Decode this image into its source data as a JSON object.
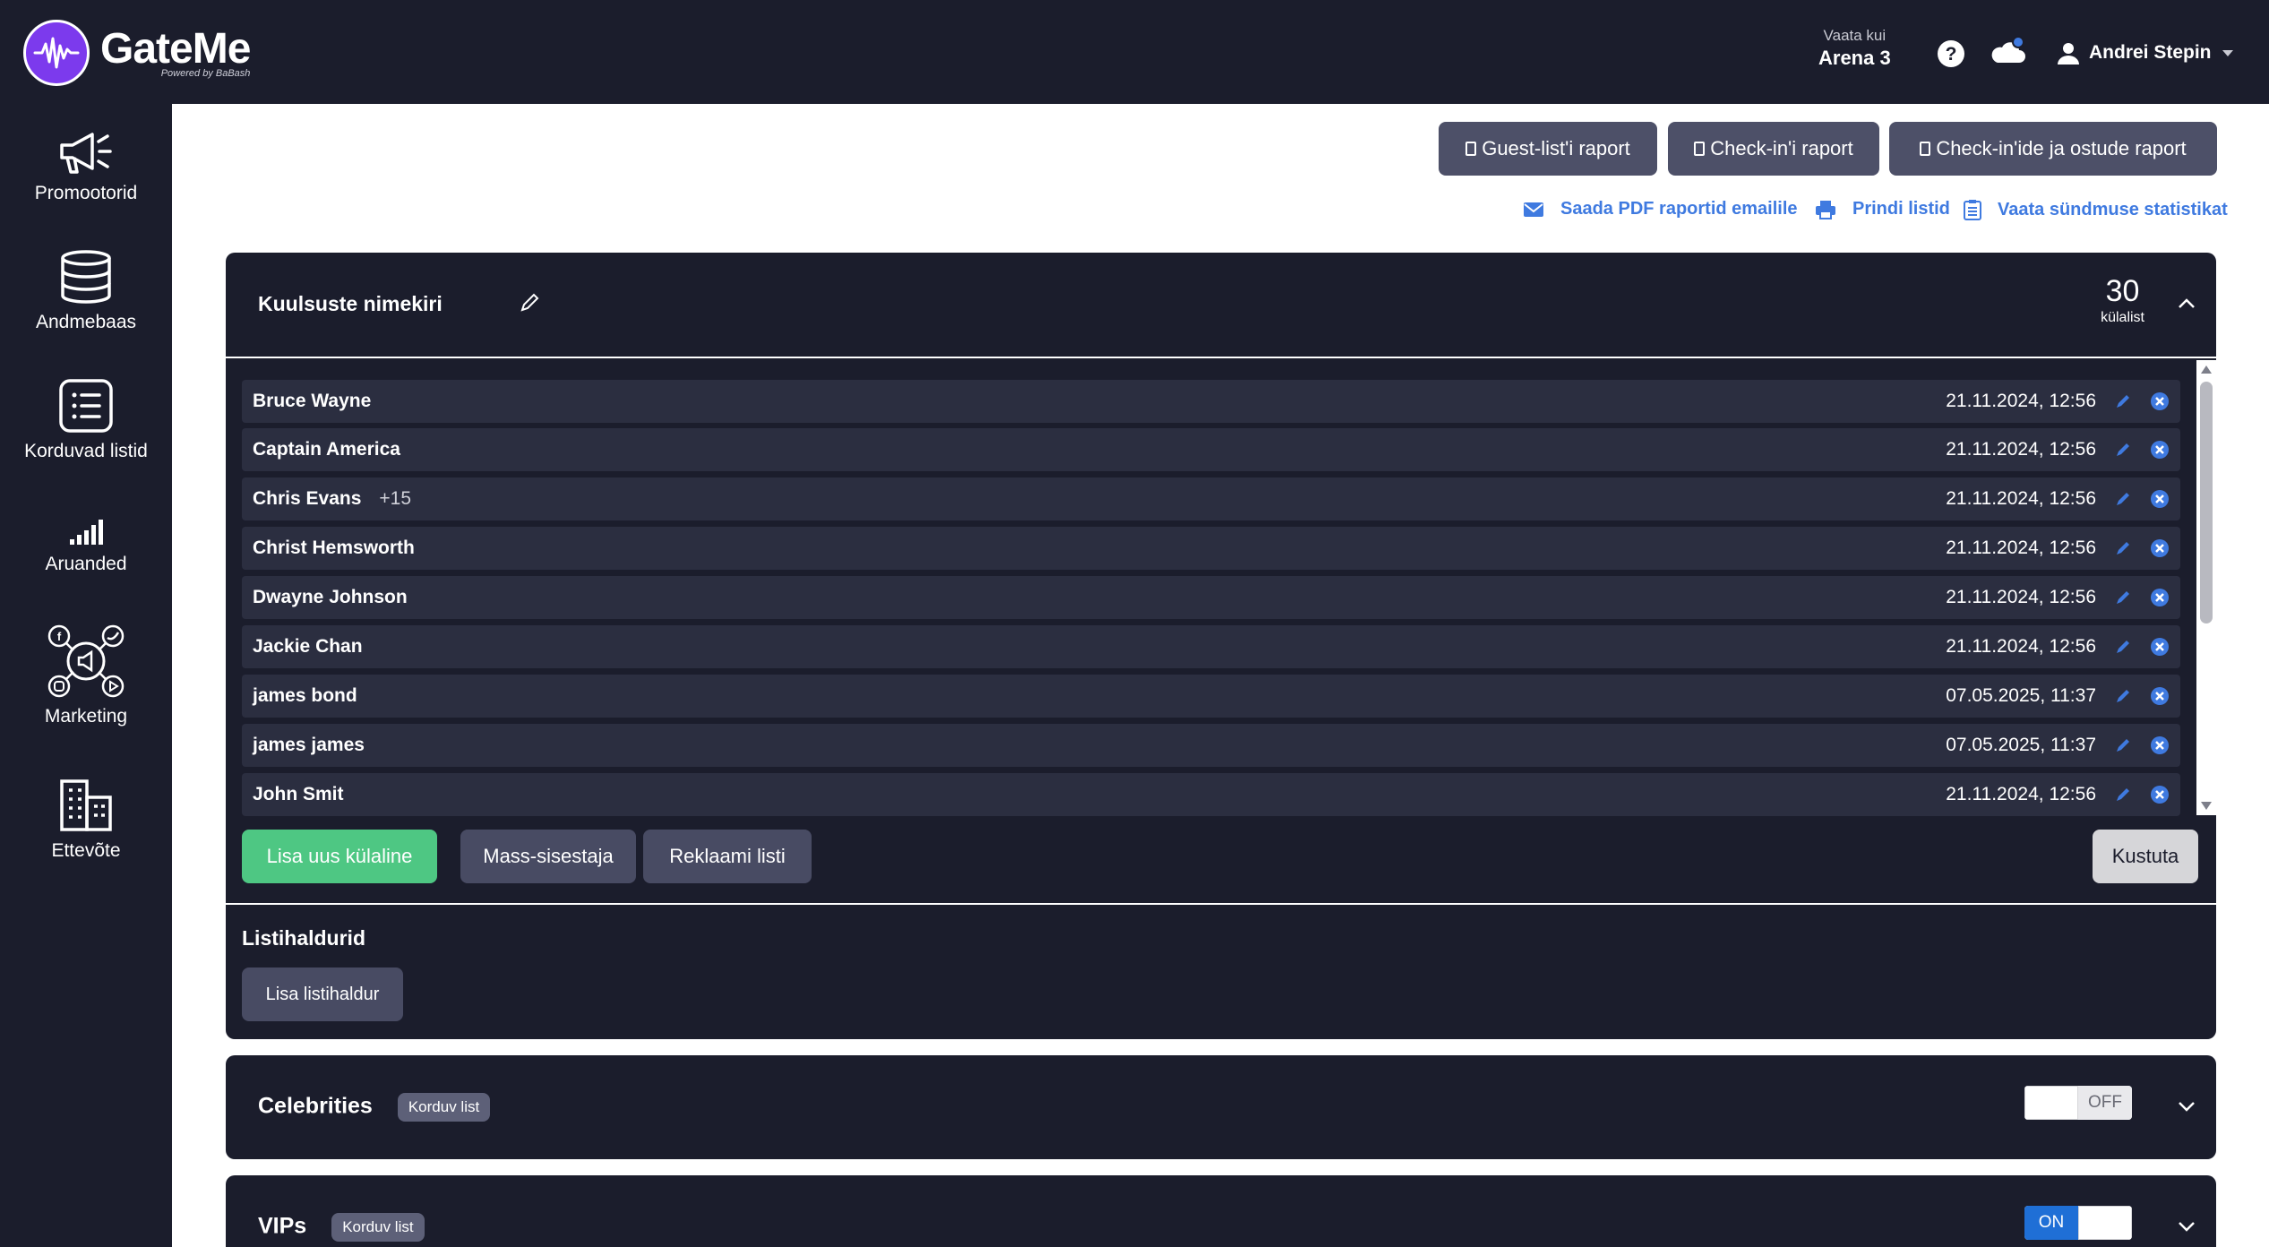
{
  "brand": {
    "name": "GateMe",
    "tagline": "Powered by BaBash",
    "accent": "#7c3aed"
  },
  "header": {
    "venue_label": "Vaata kui",
    "venue_name": "Arena 3",
    "user_name": "Andrei Stepin"
  },
  "sidebar": {
    "items": [
      {
        "label": "Promootorid",
        "icon": "megaphone-icon"
      },
      {
        "label": "Andmebaas",
        "icon": "database-icon"
      },
      {
        "label": "Korduvad listid",
        "icon": "list-icon"
      },
      {
        "label": "Aruanded",
        "icon": "signal-bars-icon"
      },
      {
        "label": "Marketing",
        "icon": "social-network-icon"
      },
      {
        "label": "Ettevõte",
        "icon": "building-icon"
      }
    ]
  },
  "reports": {
    "buttons": [
      "Guest-list'i raport",
      "Check-in'i raport",
      "Check-in'ide ja ostude raport"
    ],
    "links": [
      "Saada PDF raportid emailile",
      "Prindi listid",
      "Vaata sündmuse statistikat"
    ]
  },
  "lists": [
    {
      "title": "Kuulsuste nimekiri",
      "count": "30",
      "count_label": "külalist",
      "guests": [
        {
          "name": "Bruce Wayne",
          "plus": "",
          "date": "21.11.2024, 12:56"
        },
        {
          "name": "Captain America",
          "plus": "",
          "date": "21.11.2024, 12:56"
        },
        {
          "name": "Chris Evans",
          "plus": "+15",
          "date": "21.11.2024, 12:56"
        },
        {
          "name": "Christ Hemsworth",
          "plus": "",
          "date": "21.11.2024, 12:56"
        },
        {
          "name": "Dwayne Johnson",
          "plus": "",
          "date": "21.11.2024, 12:56"
        },
        {
          "name": "Jackie Chan",
          "plus": "",
          "date": "21.11.2024, 12:56"
        },
        {
          "name": "james bond",
          "plus": "",
          "date": "07.05.2025, 11:37"
        },
        {
          "name": "james james",
          "plus": "",
          "date": "07.05.2025, 11:37"
        },
        {
          "name": "John Smit",
          "plus": "",
          "date": "21.11.2024, 12:56"
        }
      ],
      "actions": {
        "add_guest": "Lisa uus külaline",
        "mass_entry": "Mass-sisestaja",
        "promote": "Reklaami listi",
        "delete": "Kustuta"
      },
      "managers": {
        "title": "Listihaldurid",
        "add_label": "Lisa listihaldur"
      }
    },
    {
      "title": "Celebrities",
      "badge": "Korduv list",
      "toggle": "OFF",
      "enabled": false
    },
    {
      "title": "VIPs",
      "badge": "Korduv list",
      "toggle": "ON",
      "enabled": true
    }
  ],
  "colors": {
    "dark": "#1b1d2c",
    "row": "#2b2e40",
    "green": "#4ec783",
    "link_blue": "#3f7ae0",
    "toggle_on": "#1f6fd6"
  }
}
